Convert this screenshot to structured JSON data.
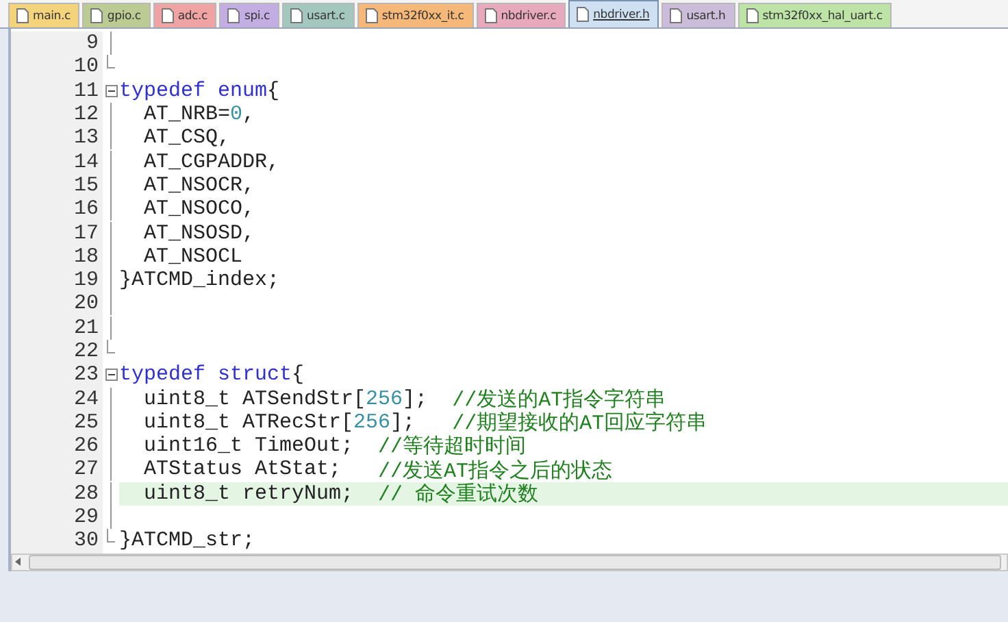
{
  "tabs": [
    {
      "label": "main.c",
      "selected": false,
      "color": "#f3d37c"
    },
    {
      "label": "gpio.c",
      "selected": false,
      "color": "#bccb93"
    },
    {
      "label": "adc.c",
      "selected": false,
      "color": "#f0a3a3"
    },
    {
      "label": "spi.c",
      "selected": false,
      "color": "#c3aee3"
    },
    {
      "label": "usart.c",
      "selected": false,
      "color": "#a3c7bd"
    },
    {
      "label": "stm32f0xx_it.c",
      "selected": false,
      "color": "#f6b878"
    },
    {
      "label": "nbdriver.c",
      "selected": false,
      "color": "#e9a9bd"
    },
    {
      "label": "nbdriver.h",
      "selected": true,
      "color": "#cfe0f2"
    },
    {
      "label": "usart.h",
      "selected": false,
      "color": "#cbbcd9"
    },
    {
      "label": "stm32f0xx_hal_uart.c",
      "selected": false,
      "color": "#bde3a6"
    }
  ],
  "editor": {
    "lines": [
      {
        "number": "9",
        "kind": "line",
        "highlighted": false
      },
      {
        "number": "10",
        "kind": "end",
        "highlighted": false
      },
      {
        "number": "11",
        "kind": "start",
        "highlighted": false,
        "segments": [
          {
            "kind": "keyword",
            "text": "typedef enum"
          },
          {
            "kind": "plain",
            "text": "{"
          }
        ]
      },
      {
        "number": "12",
        "kind": "line",
        "highlighted": false,
        "segments": [
          {
            "kind": "plain",
            "text": "  AT_NRB="
          },
          {
            "kind": "number",
            "text": "0"
          },
          {
            "kind": "plain",
            "text": ","
          }
        ]
      },
      {
        "number": "13",
        "kind": "line",
        "highlighted": false,
        "segments": [
          {
            "kind": "plain",
            "text": "  AT_CSQ,"
          }
        ]
      },
      {
        "number": "14",
        "kind": "line",
        "highlighted": false,
        "segments": [
          {
            "kind": "plain",
            "text": "  AT_CGPADDR,"
          }
        ]
      },
      {
        "number": "15",
        "kind": "line",
        "highlighted": false,
        "segments": [
          {
            "kind": "plain",
            "text": "  AT_NSOCR,"
          }
        ]
      },
      {
        "number": "16",
        "kind": "line",
        "highlighted": false,
        "segments": [
          {
            "kind": "plain",
            "text": "  AT_NSOCO,"
          }
        ]
      },
      {
        "number": "17",
        "kind": "line",
        "highlighted": false,
        "segments": [
          {
            "kind": "plain",
            "text": "  AT_NSOSD,"
          }
        ]
      },
      {
        "number": "18",
        "kind": "line",
        "highlighted": false,
        "segments": [
          {
            "kind": "plain",
            "text": "  AT_NSOCL"
          }
        ]
      },
      {
        "number": "19",
        "kind": "line",
        "highlighted": false,
        "segments": [
          {
            "kind": "plain",
            "text": "}ATCMD_index;"
          }
        ]
      },
      {
        "number": "20",
        "kind": "line",
        "highlighted": false
      },
      {
        "number": "21",
        "kind": "line",
        "highlighted": false
      },
      {
        "number": "22",
        "kind": "end",
        "highlighted": false
      },
      {
        "number": "23",
        "kind": "start",
        "highlighted": false,
        "segments": [
          {
            "kind": "keyword",
            "text": "typedef struct"
          },
          {
            "kind": "plain",
            "text": "{"
          }
        ]
      },
      {
        "number": "24",
        "kind": "line",
        "highlighted": false,
        "segments": [
          {
            "kind": "plain",
            "text": "  uint8_t ATSendStr["
          },
          {
            "kind": "number",
            "text": "256"
          },
          {
            "kind": "plain",
            "text": "];  "
          },
          {
            "kind": "comment",
            "text": "//发送的AT指令字符串"
          }
        ]
      },
      {
        "number": "25",
        "kind": "line",
        "highlighted": false,
        "segments": [
          {
            "kind": "plain",
            "text": "  uint8_t ATRecStr["
          },
          {
            "kind": "number",
            "text": "256"
          },
          {
            "kind": "plain",
            "text": "];   "
          },
          {
            "kind": "comment",
            "text": "//期望接收的AT回应字符串"
          }
        ]
      },
      {
        "number": "26",
        "kind": "line",
        "highlighted": false,
        "segments": [
          {
            "kind": "plain",
            "text": "  uint16_t TimeOut;  "
          },
          {
            "kind": "comment",
            "text": "//等待超时时间"
          }
        ]
      },
      {
        "number": "27",
        "kind": "line",
        "highlighted": false,
        "segments": [
          {
            "kind": "plain",
            "text": "  ATStatus AtStat;   "
          },
          {
            "kind": "comment",
            "text": "//发送AT指令之后的状态"
          }
        ]
      },
      {
        "number": "28",
        "kind": "line",
        "highlighted": true,
        "segments": [
          {
            "kind": "plain",
            "text": "  uint8_t retryNum;  "
          },
          {
            "kind": "comment",
            "text": "// 命令重试次数"
          }
        ]
      },
      {
        "number": "29",
        "kind": "line",
        "highlighted": false
      },
      {
        "number": "30",
        "kind": "end",
        "highlighted": false,
        "segments": [
          {
            "kind": "plain",
            "text": "}ATCMD_str;"
          }
        ]
      }
    ]
  }
}
